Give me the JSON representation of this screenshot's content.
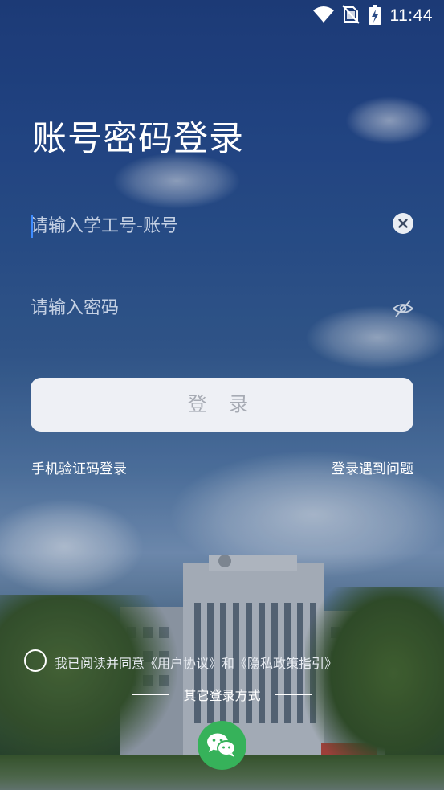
{
  "status_bar": {
    "time": "11:44",
    "icons": [
      "wifi-icon",
      "no-sim-icon",
      "battery-charging-icon"
    ]
  },
  "page": {
    "title": "账号密码登录"
  },
  "form": {
    "username_placeholder": "请输入学工号-账号",
    "username_value": "",
    "password_placeholder": "请输入密码",
    "password_value": "",
    "login_label": "登 录"
  },
  "links": {
    "sms_login": "手机验证码登录",
    "login_help": "登录遇到问题"
  },
  "agreement": {
    "prefix": "我已阅读并同意",
    "user_agreement": "《用户协议》",
    "and": "和",
    "privacy_policy": "《隐私政策指引》"
  },
  "other_login": {
    "label": "其它登录方式",
    "methods": [
      "wechat-icon"
    ]
  },
  "colors": {
    "caret": "#3f8cff",
    "login_button_bg": "#eef0f5",
    "login_button_text": "#a7abb4",
    "wechat_green": "#36b25a"
  }
}
